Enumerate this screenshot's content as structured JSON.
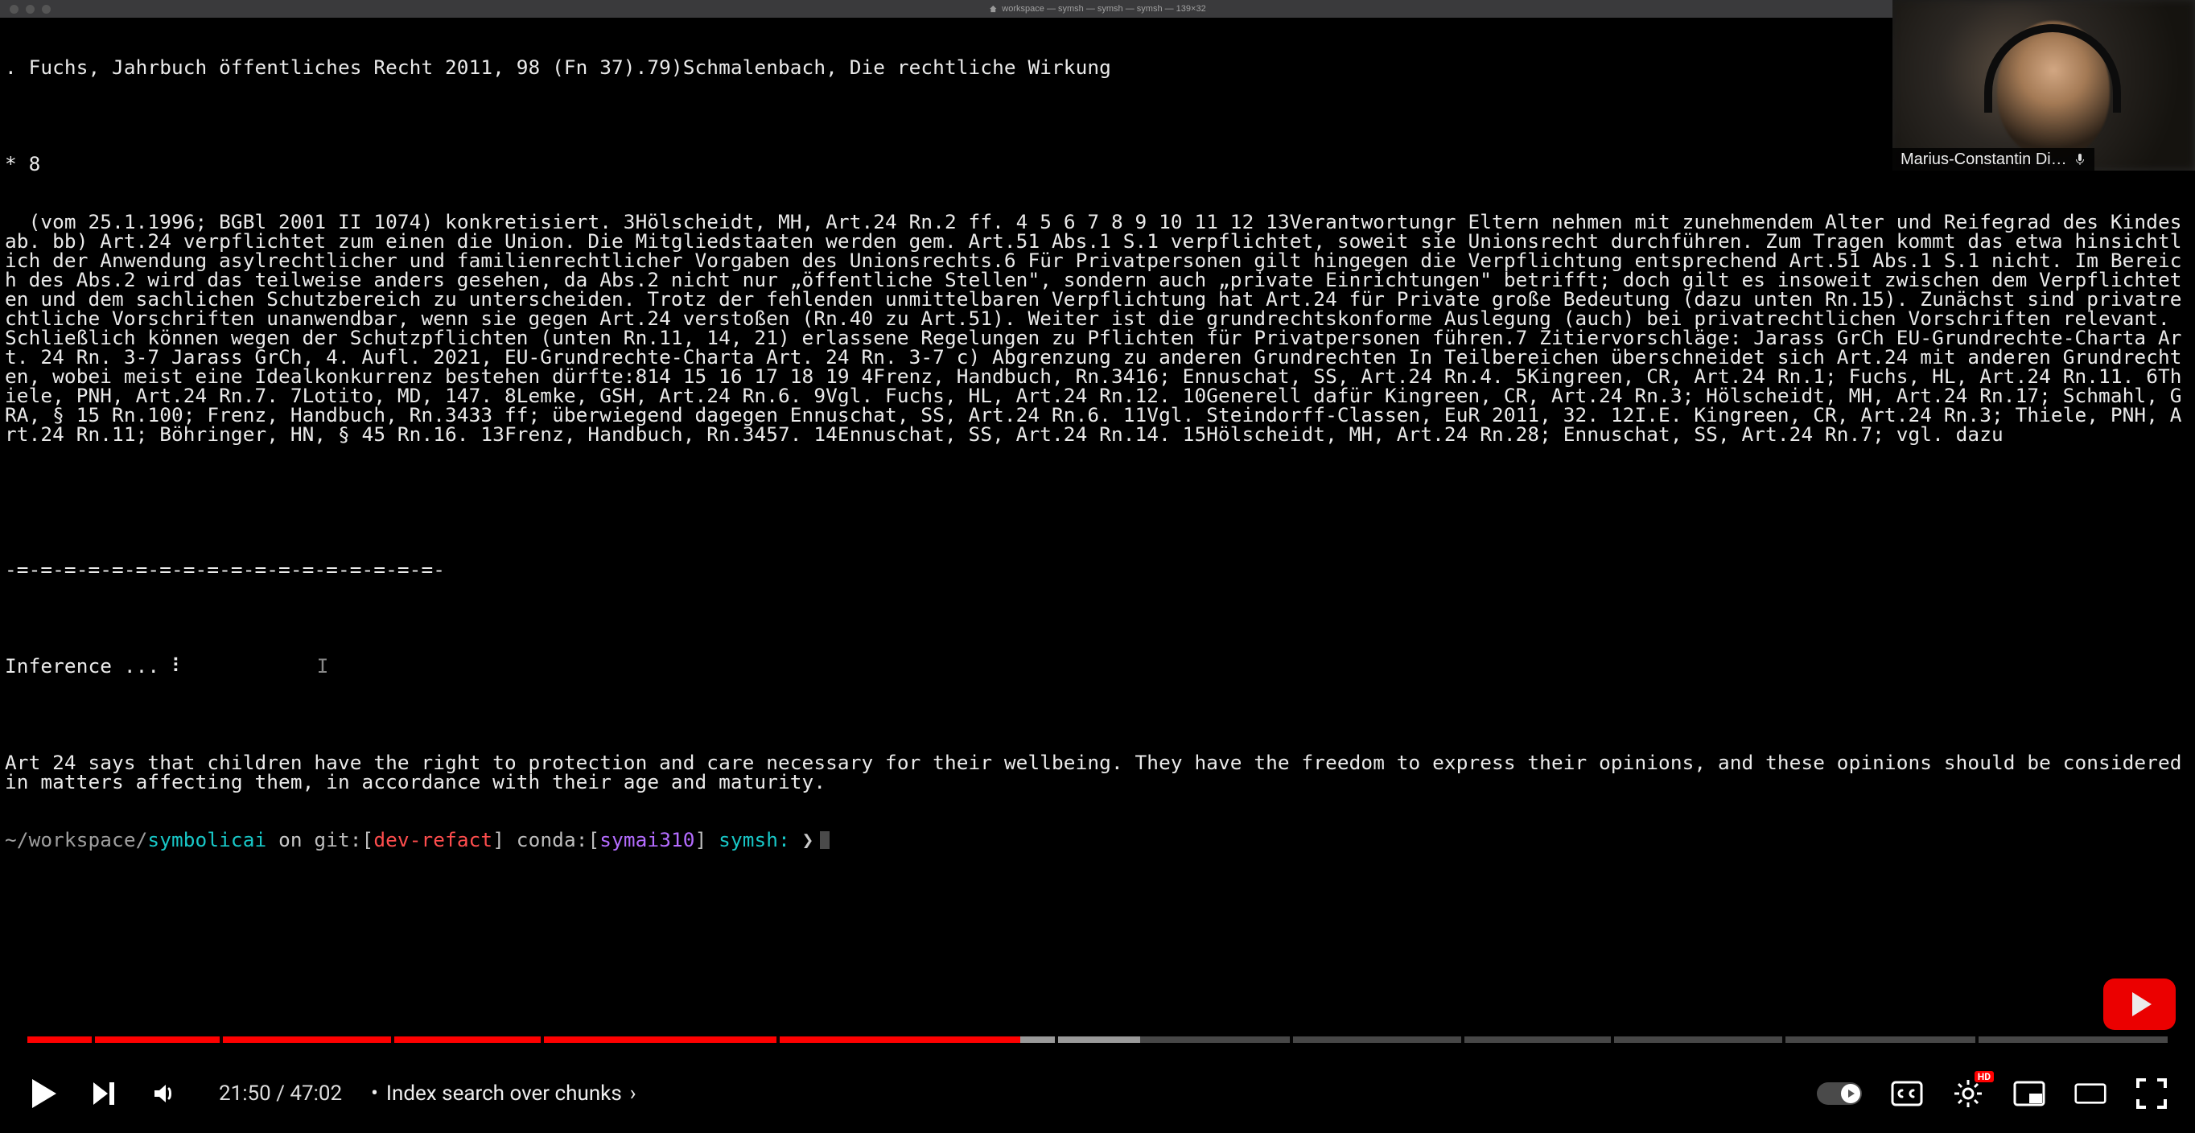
{
  "titlebar": {
    "title": "workspace — symsh — symsh — symsh — 139×32"
  },
  "webcam": {
    "name": "Marius-Constantin Di…"
  },
  "terminal": {
    "lines": [
      ". Fuchs, Jahrbuch öffentliches Recht 2011, 98 (Fn 37).79)Schmalenbach, Die rechtliche Wirkung",
      "",
      "* 8",
      "  (vom 25.1.1996; BGBl 2001 II 1074) konkretisiert. 3Hölscheidt, MH, Art.24 Rn.2 ff. 4 5 6 7 8 9 10 11 12 13Verantwortungr Eltern nehmen mit zunehmendem Alter und Reifegrad des Kindes ab. bb) Art.24 verpflichtet zum einen die Union. Die Mitgliedstaaten werden gem. Art.51 Abs.1 S.1 verpflichtet, soweit sie Unionsrecht durchführen. Zum Tragen kommt das etwa hinsichtlich der Anwendung asylrechtlicher und familienrechtlicher Vorgaben des Unionsrechts.6 Für Privatpersonen gilt hingegen die Verpflichtung entsprechend Art.51 Abs.1 S.1 nicht. Im Bereich des Abs.2 wird das teilweise anders gesehen, da Abs.2 nicht nur „öffentliche Stellen\", sondern auch „private Einrichtungen\" betrifft; doch gilt es insoweit zwischen dem Verpflichteten und dem sachlichen Schutzbereich zu unterscheiden. Trotz der fehlenden unmittelbaren Verpflichtung hat Art.24 für Private große Bedeutung (dazu unten Rn.15). Zunächst sind privatrechtliche Vorschriften unanwendbar, wenn sie gegen Art.24 verstoßen (Rn.40 zu Art.51). Weiter ist die grundrechtskonforme Auslegung (auch) bei privatrechtlichen Vorschriften relevant. Schließlich können wegen der Schutzpflichten (unten Rn.11, 14, 21) erlassene Regelungen zu Pflichten für Privatpersonen führen.7 Zitiervorschläge: Jarass GrCh EU-Grundrechte-Charta Art. 24 Rn. 3-7 Jarass GrCh, 4. Aufl. 2021, EU-Grundrechte-Charta Art. 24 Rn. 3-7 c) Abgrenzung zu anderen Grundrechten In Teilbereichen überschneidet sich Art.24 mit anderen Grundrechten, wobei meist eine Idealkonkurrenz bestehen dürfte:814 15 16 17 18 19 4Frenz, Handbuch, Rn.3416; Ennuschat, SS, Art.24 Rn.4. 5Kingreen, CR, Art.24 Rn.1; Fuchs, HL, Art.24 Rn.11. 6Thiele, PNH, Art.24 Rn.7. 7Lotito, MD, 147. 8Lemke, GSH, Art.24 Rn.6. 9Vgl. Fuchs, HL, Art.24 Rn.12. 10Generell dafür Kingreen, CR, Art.24 Rn.3; Hölscheidt, MH, Art.24 Rn.17; Schmahl, GRA, § 15 Rn.100; Frenz, Handbuch, Rn.3433 ff; überwiegend dagegen Ennuschat, SS, Art.24 Rn.6. 11Vgl. Steindorff-Classen, EuR 2011, 32. 12I.E. Kingreen, CR, Art.24 Rn.3; Thiele, PNH, Art.24 Rn.11; Böhringer, HN, § 45 Rn.16. 13Frenz, Handbuch, Rn.3457. 14Ennuschat, SS, Art.24 Rn.14. 15Hölscheidt, MH, Art.24 Rn.28; Ennuschat, SS, Art.24 Rn.7; vgl. dazu",
      "",
      "",
      "-=-=-=-=-=-=-=-=-=-=-=-=-=-=-=-=-=-=-",
      "",
      "Inference ... ⠇",
      "",
      "Art 24 says that children have the right to protection and care necessary for their wellbeing. They have the freedom to express their opinions, and these opinions should be considered in matters affecting them, in accordance with their age and maturity."
    ],
    "prompt": {
      "path_prefix": "~/workspace/",
      "path_repo": "symbolicai",
      "on": " on ",
      "git_label": "git:[",
      "git_branch": "dev-refact",
      "git_close": "]",
      "conda_label": " conda:[",
      "conda_env": "symai310",
      "conda_close": "]",
      "shell": " symsh: ",
      "arrow": "❯"
    },
    "caret": "I"
  },
  "player": {
    "time_current": "21:50",
    "time_total": "47:02",
    "separator": " / ",
    "dot": " • ",
    "chapter": "Index search over chunks",
    "progress_played_pct": 46.4,
    "progress_buffered_pct": 52,
    "chapter_ticks_pct": [
      3,
      9,
      17,
      24,
      35,
      48,
      59,
      67,
      74,
      82,
      91
    ],
    "settings_badge": "HD"
  }
}
